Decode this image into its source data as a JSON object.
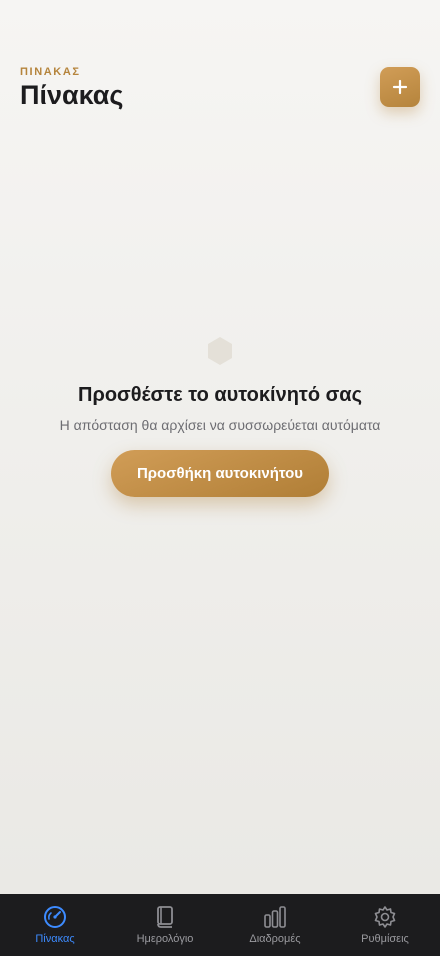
{
  "header": {
    "eyebrow": "ΠΙΝΑΚΑΣ",
    "title": "Πίνακας",
    "add_icon": "plus-icon"
  },
  "empty_state": {
    "icon": "hexagon-icon",
    "title": "Προσθέστε το αυτοκίνητό σας",
    "subtitle": "Η απόσταση θα αρχίσει να συσσωρεύεται αυτόματα",
    "button_label": "Προσθήκη αυτοκινήτου"
  },
  "tabbar": {
    "active": "dashboard",
    "tabs": [
      {
        "label": "Πίνακας",
        "icon": "speedometer-icon"
      },
      {
        "label": "Ημερολόγιο",
        "icon": "book-icon"
      },
      {
        "label": "Διαδρομές",
        "icon": "bar-chart-icon"
      },
      {
        "label": "Ρυθμίσεις",
        "icon": "gear-icon"
      }
    ]
  },
  "colors": {
    "accent": "#b5843c",
    "tab_active": "#3d8bff",
    "tabbar_bg": "#1c1c1e"
  }
}
